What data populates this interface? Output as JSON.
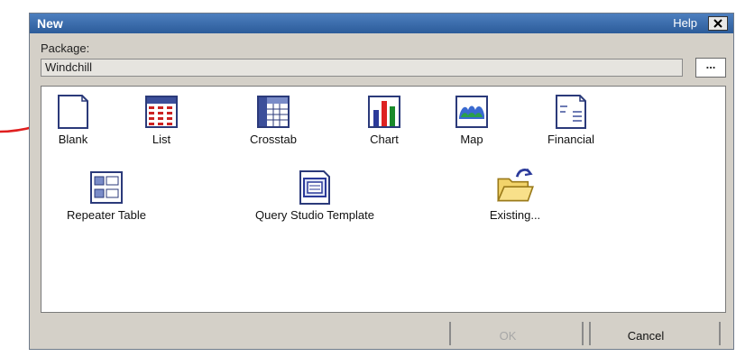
{
  "dialog": {
    "title": "New",
    "help_label": "Help",
    "close_icon": "close-icon"
  },
  "package": {
    "label": "Package:",
    "value": "Windchill",
    "browse_label": "..."
  },
  "templates": [
    {
      "label": "Blank",
      "icon": "blank-report-icon"
    },
    {
      "label": "List",
      "icon": "list-report-icon"
    },
    {
      "label": "Crosstab",
      "icon": "crosstab-report-icon"
    },
    {
      "label": "Chart",
      "icon": "chart-report-icon"
    },
    {
      "label": "Map",
      "icon": "map-report-icon"
    },
    {
      "label": "Financial",
      "icon": "financial-report-icon"
    },
    {
      "label": "Repeater Table",
      "icon": "repeater-table-icon"
    },
    {
      "label": "Query Studio Template",
      "icon": "query-studio-template-icon"
    },
    {
      "label": "Existing...",
      "icon": "open-folder-icon"
    }
  ],
  "buttons": {
    "ok_label": "OK",
    "cancel_label": "Cancel"
  },
  "colors": {
    "titlebar": "#2c5c9a",
    "dialog_bg": "#d4d0c8",
    "annotation_arrow": "#e02020"
  }
}
